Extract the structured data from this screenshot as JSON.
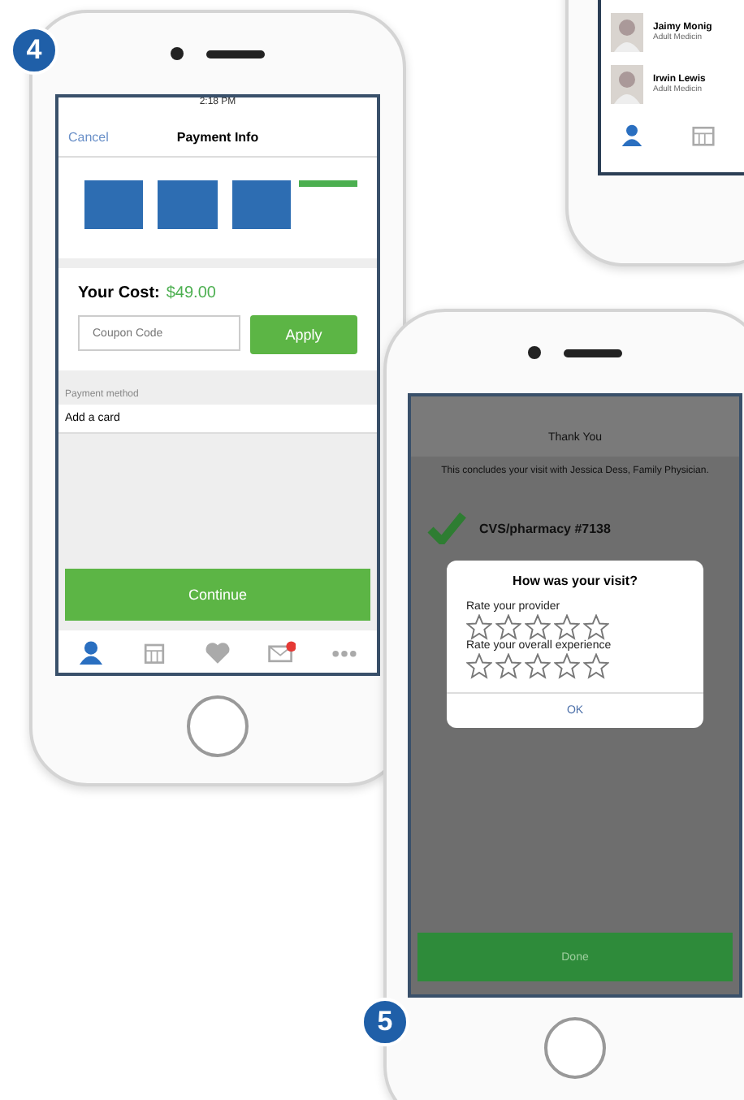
{
  "doctor_list_phone": {
    "doctors": [
      {
        "name": "Jaimy Monig",
        "specialty": "Adult Medicin"
      },
      {
        "name": "Irwin Lewis",
        "specialty": "Adult Medicin"
      }
    ],
    "tab_bar": [
      {
        "kind": "person",
        "selected": true
      },
      {
        "kind": "calendar",
        "selected": false
      }
    ]
  },
  "payment_phone": {
    "step": "4",
    "status_bar": {
      "time": "2:18 PM"
    },
    "nav": {
      "cancel": "Cancel",
      "title": "Payment Info"
    },
    "progress": [
      {
        "kind": "done"
      },
      {
        "kind": "done"
      },
      {
        "kind": "done"
      },
      {
        "kind": "current"
      }
    ],
    "cost_label": "Your Cost:",
    "cost_value": "$49.00",
    "coupon": {
      "placeholder": "Coupon Code"
    },
    "apply": "Apply",
    "payment_method_label": "Payment method",
    "add_card": "Add a card",
    "continue": "Continue",
    "tab_bar": [
      {
        "kind": "person",
        "selected": true,
        "badge": false
      },
      {
        "kind": "calendar",
        "selected": false,
        "badge": false
      },
      {
        "kind": "heart",
        "selected": false,
        "badge": false
      },
      {
        "kind": "mail",
        "selected": false,
        "badge": true
      },
      {
        "kind": "more",
        "selected": false,
        "badge": false
      }
    ]
  },
  "rating_phone": {
    "step": "5",
    "title": "Thank You",
    "message": "This concludes your visit with Jessica Dess, Family Physician.",
    "pharmacy": "CVS/pharmacy #7138",
    "dialog": {
      "title": "How was your visit?",
      "ratings": [
        {
          "label": "Rate your provider",
          "stars": 0
        },
        {
          "label": "Rate your overall experience",
          "stars": 0
        }
      ],
      "ok": "OK"
    },
    "done": "Done"
  }
}
